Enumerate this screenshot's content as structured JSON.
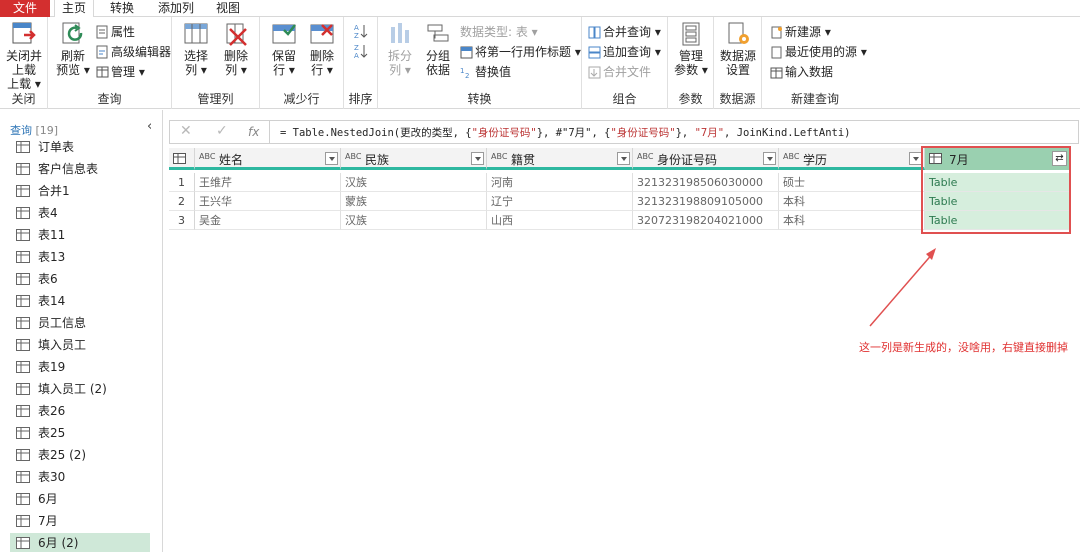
{
  "tabs": [
    "文件",
    "主页",
    "转换",
    "添加列",
    "视图"
  ],
  "ribbon": {
    "close": {
      "btn": "关闭并上载",
      "btn2": "上载 ▾",
      "group": "关闭"
    },
    "query": {
      "refresh1": "刷新",
      "refresh2": "预览 ▾",
      "props": "属性",
      "adv": "高级编辑器",
      "manage": "管理 ▾",
      "group": "查询"
    },
    "managecols": {
      "choose1": "选择",
      "choose2": "列 ▾",
      "remove1": "删除",
      "remove2": "列 ▾",
      "group": "管理列"
    },
    "reducerows": {
      "keep1": "保留",
      "keep2": "行 ▾",
      "remove1": "删除",
      "remove2": "行 ▾",
      "group": "减少行"
    },
    "sort": {
      "group": "排序"
    },
    "transform": {
      "split1": "拆分",
      "split2": "列 ▾",
      "groupby1": "分组",
      "groupby2": "依据",
      "datatype": "数据类型: 表 ▾",
      "firstrow": "将第一行用作标题 ▾",
      "replace": "替换值",
      "group": "转换"
    },
    "combine": {
      "merge": "合并查询 ▾",
      "append": "追加查询 ▾",
      "files": "合并文件",
      "group": "组合"
    },
    "params": {
      "btn1": "管理",
      "btn2": "参数 ▾",
      "group": "参数"
    },
    "datasource": {
      "btn1": "数据源",
      "btn2": "设置",
      "group": "数据源"
    },
    "newquery": {
      "newsrc": "新建源 ▾",
      "recent": "最近使用的源 ▾",
      "enter": "输入数据",
      "group": "新建查询"
    }
  },
  "queries": {
    "header": "查询",
    "count": "[19]",
    "items": [
      "订单表",
      "客户信息表",
      "合并1",
      "表4",
      "表11",
      "表13",
      "表6",
      "表14",
      "员工信息",
      "填入员工",
      "表19",
      "填入员工 (2)",
      "表26",
      "表25",
      "表25 (2)",
      "表30",
      "6月",
      "7月",
      "6月 (2)"
    ]
  },
  "formula": {
    "fx": "fx",
    "p1": "= Table.NestedJoin(更改的类型, {",
    "s1": "\"身份证号码\"",
    "p2": "}, #\"7月\", {",
    "s2": "\"身份证号码\"",
    "p3": "}, ",
    "s3": "\"7月\"",
    "p4": ", JoinKind.LeftAnti)"
  },
  "table": {
    "abc": "ABC",
    "headers": [
      "姓名",
      "民族",
      "籍贯",
      "身份证号码",
      "学历",
      "7月"
    ],
    "rows": [
      {
        "n": "1",
        "c": [
          "王维芹",
          "汉族",
          "河南",
          "321323198506030000",
          "硕士",
          "Table"
        ]
      },
      {
        "n": "2",
        "c": [
          "王兴华",
          "蒙族",
          "辽宁",
          "321323198809105000",
          "本科",
          "Table"
        ]
      },
      {
        "n": "3",
        "c": [
          "吴金",
          "汉族",
          "山西",
          "320723198204021000",
          "本科",
          "Table"
        ]
      }
    ]
  },
  "annotation": "这一列是新生成的，没啥用，右键直接删掉",
  "colors": {
    "file_tab": "#d32f2f",
    "accent": "#2eb8a0",
    "highlight": "#e05050",
    "selected": "#cfe8d8"
  }
}
